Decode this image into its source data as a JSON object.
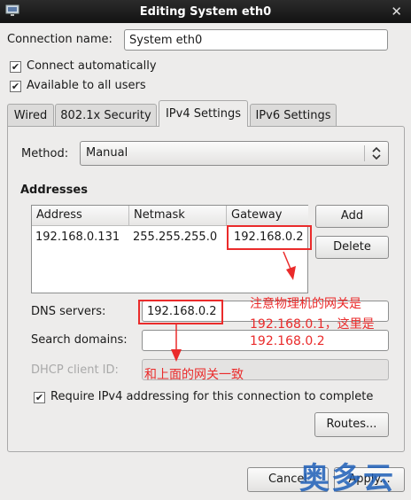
{
  "window": {
    "title": "Editing System eth0"
  },
  "connection_name": {
    "label": "Connection name:",
    "value": "System eth0"
  },
  "options": {
    "connect_automatically": {
      "label": "Connect automatically",
      "checked": true
    },
    "available_to_all": {
      "label": "Available to all users",
      "checked": true
    }
  },
  "tabs": [
    {
      "label": "Wired",
      "active": false
    },
    {
      "label": "802.1x Security",
      "active": false
    },
    {
      "label": "IPv4 Settings",
      "active": true
    },
    {
      "label": "IPv6 Settings",
      "active": false
    }
  ],
  "ipv4": {
    "method_label": "Method:",
    "method_value": "Manual",
    "addresses_heading": "Addresses",
    "columns": [
      "Address",
      "Netmask",
      "Gateway"
    ],
    "rows": [
      {
        "address": "192.168.0.131",
        "netmask": "255.255.255.0",
        "gateway": "192.168.0.2"
      }
    ],
    "add_button": "Add",
    "delete_button": "Delete",
    "dns_label": "DNS servers:",
    "dns_value": "192.168.0.2",
    "search_label": "Search domains:",
    "search_value": "",
    "dhcp_label": "DHCP client ID:",
    "dhcp_value": "",
    "require_label": "Require IPv4 addressing for this connection to complete",
    "require_checked": true,
    "routes_button": "Routes..."
  },
  "footer": {
    "cancel": "Cancel",
    "apply": "Apply..."
  },
  "annotations": {
    "note1_line1": "注意物理机的网关是",
    "note1_line2": "192.168.0.1，这里是",
    "note1_line3": "192.168.0.2",
    "note2": "和上面的网关一致",
    "color": "#ea2b2b"
  },
  "watermark": "奥多云",
  "icons": [
    "network-icon",
    "close-icon",
    "check-icon",
    "combo-arrows-icon",
    "arrow-down-icon"
  ]
}
